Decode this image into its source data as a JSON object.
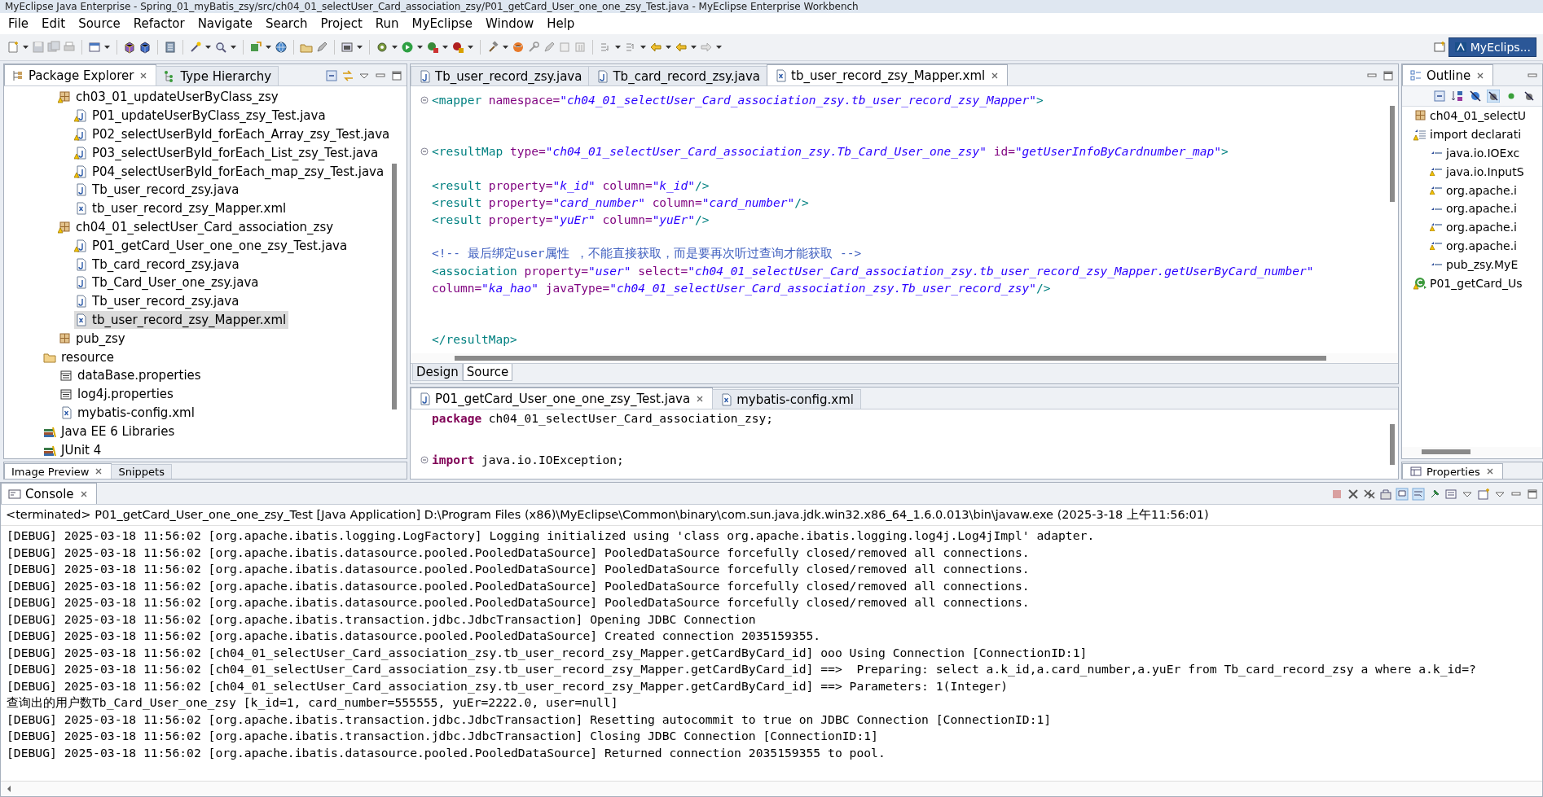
{
  "window": {
    "title": "MyEclipse Java Enterprise - Spring_01_myBatis_zsy/src/ch04_01_selectUser_Card_association_zsy/P01_getCard_User_one_one_zsy_Test.java - MyEclipse Enterprise Workbench"
  },
  "menu_bar": [
    "File",
    "Edit",
    "Source",
    "Refactor",
    "Navigate",
    "Search",
    "Project",
    "Run",
    "MyEclipse",
    "Window",
    "Help"
  ],
  "perspective": {
    "label": "MyEclips...",
    "selected": true
  },
  "package_explorer": {
    "tabs": [
      {
        "label": "Package Explorer",
        "selected": true
      },
      {
        "label": "Type Hierarchy",
        "selected": false
      }
    ],
    "tree": [
      {
        "kind": "package",
        "label": "ch03_01_updateUserByClass_zsy",
        "warning": true,
        "selected": false,
        "children": [
          {
            "kind": "java",
            "label": "P01_updateUserByClass_zsy_Test.java",
            "warning": true,
            "selected": false
          },
          {
            "kind": "java",
            "label": "P02_selectUserById_forEach_Array_zsy_Test.java",
            "warning": true,
            "selected": false
          },
          {
            "kind": "java",
            "label": "P03_selectUserById_forEach_List_zsy_Test.java",
            "warning": true,
            "selected": false
          },
          {
            "kind": "java",
            "label": "P04_selectUserById_forEach_map_zsy_Test.java",
            "warning": true,
            "selected": false
          },
          {
            "kind": "java",
            "label": "Tb_user_record_zsy.java",
            "warning": false,
            "selected": false
          },
          {
            "kind": "xml",
            "label": "tb_user_record_zsy_Mapper.xml",
            "warning": false,
            "selected": false
          }
        ]
      },
      {
        "kind": "package",
        "label": "ch04_01_selectUser_Card_association_zsy",
        "warning": true,
        "selected": false,
        "children": [
          {
            "kind": "java",
            "label": "P01_getCard_User_one_one_zsy_Test.java",
            "warning": true,
            "selected": false
          },
          {
            "kind": "java",
            "label": "Tb_card_record_zsy.java",
            "warning": false,
            "selected": false
          },
          {
            "kind": "java",
            "label": "Tb_Card_User_one_zsy.java",
            "warning": false,
            "selected": false
          },
          {
            "kind": "java",
            "label": "Tb_user_record_zsy.java",
            "warning": false,
            "selected": false
          },
          {
            "kind": "xml",
            "label": "tb_user_record_zsy_Mapper.xml",
            "warning": false,
            "selected": true
          }
        ]
      },
      {
        "kind": "package",
        "label": "pub_zsy",
        "warning": false,
        "selected": false
      },
      {
        "kind": "folder",
        "label": "resource",
        "warning": false,
        "selected": false,
        "children": [
          {
            "kind": "properties",
            "label": "dataBase.properties",
            "warning": false,
            "selected": false
          },
          {
            "kind": "properties",
            "label": "log4j.properties",
            "warning": false,
            "selected": false
          },
          {
            "kind": "xml",
            "label": "mybatis-config.xml",
            "warning": false,
            "selected": false
          }
        ]
      },
      {
        "kind": "library",
        "label": "Java EE 6 Libraries",
        "warning": false,
        "selected": false
      },
      {
        "kind": "library",
        "label": "JUnit 4",
        "warning": false,
        "selected": false
      }
    ]
  },
  "lower_left_tabs": [
    {
      "label": "Image Preview",
      "selected": true
    },
    {
      "label": "Snippets",
      "selected": false
    }
  ],
  "editor": {
    "tabs": [
      {
        "kind": "java",
        "label": "Tb_user_record_zsy.java",
        "selected": false
      },
      {
        "kind": "java",
        "label": "Tb_card_record_zsy.java",
        "selected": false
      },
      {
        "kind": "xml",
        "label": "tb_user_record_zsy_Mapper.xml",
        "selected": true
      }
    ],
    "lines": [
      {
        "fold": true,
        "tokens": [
          {
            "kind": "tag",
            "text": "<mapper "
          },
          {
            "kind": "attr",
            "text": "namespace="
          },
          {
            "kind": "value",
            "text": "\"ch04_01_selectUser_Card_association_zsy.tb_user_record_zsy_Mapper\""
          },
          {
            "kind": "tag",
            "text": ">"
          }
        ]
      },
      {
        "fold": false
      },
      {
        "fold": false
      },
      {
        "fold": true,
        "tokens": [
          {
            "kind": "tag",
            "text": "<resultMap "
          },
          {
            "kind": "attr",
            "text": "type="
          },
          {
            "kind": "value",
            "text": "\"ch04_01_selectUser_Card_association_zsy.Tb_Card_User_one_zsy\" "
          },
          {
            "kind": "attr",
            "text": "id="
          },
          {
            "kind": "value",
            "text": "\"getUserInfoByCardnumber_map\""
          },
          {
            "kind": "tag",
            "text": ">"
          }
        ]
      },
      {
        "fold": false
      },
      {
        "fold": false,
        "tokens": [
          {
            "kind": "tag",
            "text": "<result "
          },
          {
            "kind": "attr",
            "text": "property="
          },
          {
            "kind": "value",
            "text": "\"k_id\" "
          },
          {
            "kind": "attr",
            "text": "column="
          },
          {
            "kind": "value",
            "text": "\"k_id\""
          },
          {
            "kind": "tag",
            "text": "/>"
          }
        ]
      },
      {
        "fold": false,
        "tokens": [
          {
            "kind": "tag",
            "text": "<result "
          },
          {
            "kind": "attr",
            "text": "property="
          },
          {
            "kind": "value",
            "text": "\"card_number\" "
          },
          {
            "kind": "attr",
            "text": "column="
          },
          {
            "kind": "value",
            "text": "\"card_number\""
          },
          {
            "kind": "tag",
            "text": "/>"
          }
        ]
      },
      {
        "fold": false,
        "tokens": [
          {
            "kind": "tag",
            "text": "<result "
          },
          {
            "kind": "attr",
            "text": "property="
          },
          {
            "kind": "value",
            "text": "\"yuEr\" "
          },
          {
            "kind": "attr",
            "text": "column="
          },
          {
            "kind": "value",
            "text": "\"yuEr\""
          },
          {
            "kind": "tag",
            "text": "/>"
          }
        ]
      },
      {
        "fold": false
      },
      {
        "fold": false,
        "tokens": [
          {
            "kind": "comment",
            "text": "<!-- 最后绑定user属性 ，不能直接获取，而是要再次听过查询才能获取 -->"
          }
        ]
      },
      {
        "fold": false,
        "tokens": [
          {
            "kind": "tag",
            "text": "<association "
          },
          {
            "kind": "attr",
            "text": "property="
          },
          {
            "kind": "value",
            "text": "\"user\" "
          },
          {
            "kind": "attr",
            "text": "select="
          },
          {
            "kind": "value",
            "text": "\"ch04_01_selectUser_Card_association_zsy.tb_user_record_zsy_Mapper.getUserByCard_number\""
          }
        ]
      },
      {
        "fold": false,
        "tokens": [
          {
            "kind": "attr",
            "text": "column="
          },
          {
            "kind": "value",
            "text": "\"ka_hao\" "
          },
          {
            "kind": "attr",
            "text": "javaType="
          },
          {
            "kind": "value",
            "text": "\"ch04_01_selectUser_Card_association_zsy.Tb_user_record_zsy\""
          },
          {
            "kind": "tag",
            "text": "/>"
          }
        ]
      },
      {
        "fold": false
      },
      {
        "fold": false
      },
      {
        "fold": false,
        "tokens": [
          {
            "kind": "tag",
            "text": "</resultMap>"
          }
        ]
      }
    ],
    "mode_tabs": [
      {
        "label": "Design",
        "selected": false
      },
      {
        "label": "Source",
        "selected": true
      }
    ]
  },
  "editor_2": {
    "tabs": [
      {
        "kind": "java",
        "label": "P01_getCard_User_one_one_zsy_Test.java",
        "selected": true
      },
      {
        "kind": "xml",
        "label": "mybatis-config.xml",
        "selected": false
      }
    ],
    "lines": [
      {
        "fold": false,
        "tokens": [
          {
            "kind": "keyword",
            "text": "package "
          },
          {
            "kind": "text",
            "text": "ch04_01_selectUser_Card_association_zsy;"
          }
        ]
      },
      {
        "fold": false
      },
      {
        "fold": false
      },
      {
        "fold": true,
        "tokens": [
          {
            "kind": "keyword",
            "text": "import "
          },
          {
            "kind": "text",
            "text": "java.io.IOException;"
          }
        ]
      }
    ]
  },
  "outline": {
    "tabs": [
      {
        "label": "Outline",
        "selected": true
      }
    ],
    "tree": [
      {
        "kind": "package",
        "label": "ch04_01_selectU",
        "warning": false,
        "selected": false
      },
      {
        "kind": "imports",
        "label": "import declarati",
        "warning": true,
        "selected": false,
        "children": [
          {
            "kind": "import",
            "label": "java.io.IOExc",
            "warning": false,
            "selected": false
          },
          {
            "kind": "import",
            "label": "java.io.InputS",
            "warning": true,
            "selected": false
          },
          {
            "kind": "import",
            "label": "org.apache.i",
            "warning": true,
            "selected": false
          },
          {
            "kind": "import",
            "label": "org.apache.i",
            "warning": false,
            "selected": false
          },
          {
            "kind": "import",
            "label": "org.apache.i",
            "warning": true,
            "selected": false
          },
          {
            "kind": "import",
            "label": "org.apache.i",
            "warning": true,
            "selected": false
          },
          {
            "kind": "import",
            "label": "pub_zsy.MyE",
            "warning": false,
            "selected": false
          }
        ]
      },
      {
        "kind": "class",
        "label": "P01_getCard_Us",
        "warning": true,
        "selected": false
      }
    ]
  },
  "lower_right_tabs": [
    {
      "label": "Properties",
      "selected": true
    }
  ],
  "console": {
    "tabs": [
      {
        "label": "Console",
        "selected": true
      }
    ],
    "status": "<terminated> P01_getCard_User_one_one_zsy_Test [Java Application] D:\\Program Files (x86)\\MyEclipse\\Common\\binary\\com.sun.java.jdk.win32.x86_64_1.6.0.013\\bin\\javaw.exe (2025-3-18 上午11:56:01)",
    "lines": [
      "[DEBUG] 2025-03-18 11:56:02 [org.apache.ibatis.logging.LogFactory] Logging initialized using 'class org.apache.ibatis.logging.log4j.Log4jImpl' adapter.",
      "[DEBUG] 2025-03-18 11:56:02 [org.apache.ibatis.datasource.pooled.PooledDataSource] PooledDataSource forcefully closed/removed all connections.",
      "[DEBUG] 2025-03-18 11:56:02 [org.apache.ibatis.datasource.pooled.PooledDataSource] PooledDataSource forcefully closed/removed all connections.",
      "[DEBUG] 2025-03-18 11:56:02 [org.apache.ibatis.datasource.pooled.PooledDataSource] PooledDataSource forcefully closed/removed all connections.",
      "[DEBUG] 2025-03-18 11:56:02 [org.apache.ibatis.datasource.pooled.PooledDataSource] PooledDataSource forcefully closed/removed all connections.",
      "[DEBUG] 2025-03-18 11:56:02 [org.apache.ibatis.transaction.jdbc.JdbcTransaction] Opening JDBC Connection",
      "[DEBUG] 2025-03-18 11:56:02 [org.apache.ibatis.datasource.pooled.PooledDataSource] Created connection 2035159355.",
      "[DEBUG] 2025-03-18 11:56:02 [ch04_01_selectUser_Card_association_zsy.tb_user_record_zsy_Mapper.getCardByCard_id] ooo Using Connection [ConnectionID:1]",
      "[DEBUG] 2025-03-18 11:56:02 [ch04_01_selectUser_Card_association_zsy.tb_user_record_zsy_Mapper.getCardByCard_id] ==>  Preparing: select a.k_id,a.card_number,a.yuEr from Tb_card_record_zsy a where a.k_id=?",
      "[DEBUG] 2025-03-18 11:56:02 [ch04_01_selectUser_Card_association_zsy.tb_user_record_zsy_Mapper.getCardByCard_id] ==> Parameters: 1(Integer)",
      "查询出的用户数Tb_Card_User_one_zsy [k_id=1, card_number=555555, yuEr=2222.0, user=null]",
      "[DEBUG] 2025-03-18 11:56:02 [org.apache.ibatis.transaction.jdbc.JdbcTransaction] Resetting autocommit to true on JDBC Connection [ConnectionID:1]",
      "[DEBUG] 2025-03-18 11:56:02 [org.apache.ibatis.transaction.jdbc.JdbcTransaction] Closing JDBC Connection [ConnectionID:1]",
      "[DEBUG] 2025-03-18 11:56:02 [org.apache.ibatis.datasource.pooled.PooledDataSource] Returned connection 2035159355 to pool."
    ]
  }
}
